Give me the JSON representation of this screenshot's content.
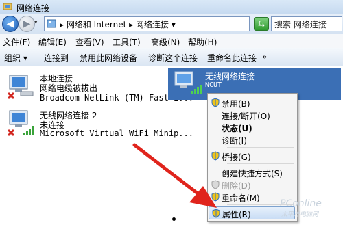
{
  "window": {
    "title": "网络连接"
  },
  "address": {
    "crumb": "▸ 网络和 Internet ▸ 网络连接 ▾",
    "search_placeholder": "搜索 网络连接"
  },
  "menu": [
    {
      "label": "文件(F)"
    },
    {
      "label": "编辑(E)"
    },
    {
      "label": "查看(V)"
    },
    {
      "label": "工具(T)"
    },
    {
      "label": "高级(N)"
    },
    {
      "label": "帮助(H)"
    }
  ],
  "toolbar": [
    {
      "label": "组织 ▾"
    },
    {
      "label": "连接到"
    },
    {
      "label": "禁用此网络设备"
    },
    {
      "label": "诊断这个连接"
    },
    {
      "label": "重命名此连接"
    },
    {
      "label": "»"
    }
  ],
  "connections": [
    {
      "name": "本地连接",
      "status": "网络电缆被拔出",
      "device": "Broadcom NetLink (TM) Fast E..."
    },
    {
      "name": "无线网络连接 2",
      "status": "未连接",
      "device": "Microsoft Virtual WiFi Minip..."
    },
    {
      "name": "无线网络连接",
      "status": "NCUT"
    }
  ],
  "context_menu": {
    "items": [
      {
        "label": "禁用(B)"
      },
      {
        "label": "连接/断开(O)"
      },
      {
        "label": "状态(U)"
      },
      {
        "label": "诊断(I)"
      },
      {
        "label": "桥接(G)"
      },
      {
        "label": "创建快捷方式(S)"
      },
      {
        "label": "删除(D)"
      },
      {
        "label": "重命名(M)"
      },
      {
        "label": "属性(R)"
      }
    ]
  },
  "watermark": {
    "brand": "PConline",
    "sub": "太平洋电脑网"
  },
  "colors": {
    "selection": "#3b6fb5",
    "arrow": "#e0241c",
    "menu_hover": "#c9ddf5"
  }
}
